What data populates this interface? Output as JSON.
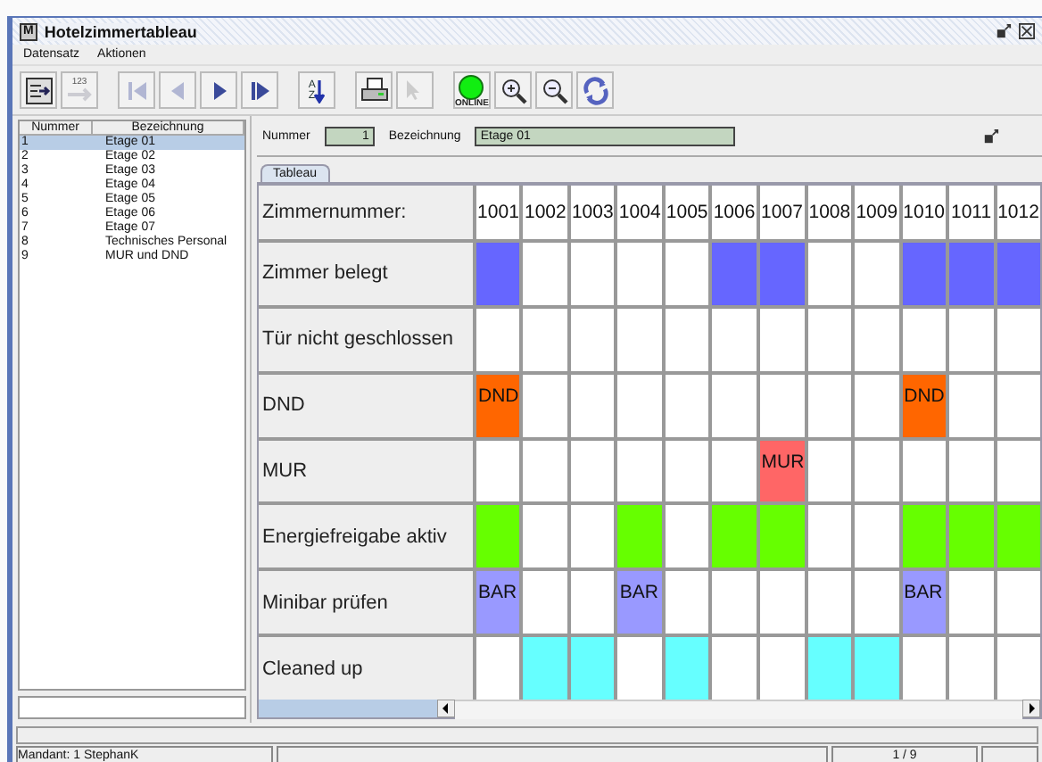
{
  "window": {
    "app_icon": "M",
    "title": "Hotelzimmertableau"
  },
  "menu": [
    "Datensatz",
    "Aktionen"
  ],
  "toolbar": [
    {
      "kind": "form",
      "disabled": false
    },
    {
      "kind": "number-arrow",
      "label": "123",
      "disabled": true
    },
    {
      "kind": "first",
      "disabled": true
    },
    {
      "kind": "prev",
      "disabled": true
    },
    {
      "kind": "next",
      "disabled": false
    },
    {
      "kind": "last",
      "disabled": false
    },
    {
      "kind": "sort",
      "label": "AZ",
      "disabled": false
    },
    {
      "kind": "print",
      "disabled": false
    },
    {
      "kind": "help",
      "disabled": true
    },
    {
      "kind": "online",
      "label": "ONLINE",
      "disabled": false
    },
    {
      "kind": "zoom-in",
      "disabled": false
    },
    {
      "kind": "zoom-out",
      "disabled": false
    },
    {
      "kind": "refresh",
      "disabled": false
    }
  ],
  "floor_list": {
    "columns": [
      "Nummer",
      "Bezeichnung"
    ],
    "rows": [
      {
        "number": "1",
        "name": "Etage 01",
        "selected": true
      },
      {
        "number": "2",
        "name": "Etage 02",
        "selected": false
      },
      {
        "number": "3",
        "name": "Etage 03",
        "selected": false
      },
      {
        "number": "4",
        "name": "Etage 04",
        "selected": false
      },
      {
        "number": "5",
        "name": "Etage 05",
        "selected": false
      },
      {
        "number": "6",
        "name": "Etage 06",
        "selected": false
      },
      {
        "number": "7",
        "name": "Etage 07",
        "selected": false
      },
      {
        "number": "8",
        "name": "Technisches Personal",
        "selected": false
      },
      {
        "number": "9",
        "name": "MUR und DND",
        "selected": false
      }
    ]
  },
  "record": {
    "number_label": "Nummer",
    "number": "1",
    "name_label": "Bezeichnung",
    "name": "Etage 01"
  },
  "tabs": [
    {
      "label": "Tableau",
      "selected": true
    }
  ],
  "tableau": {
    "header": "Zimmernummer:",
    "rooms": [
      "1001",
      "1002",
      "1003",
      "1004",
      "1005",
      "1006",
      "1007",
      "1008",
      "1009",
      "1010",
      "1011",
      "1012"
    ],
    "rows": [
      {
        "label": "Zimmer belegt",
        "cells": [
          {
            "color": "#6666ff"
          },
          {
            "color": "#ffffff"
          },
          {
            "color": "#ffffff"
          },
          {
            "color": "#ffffff"
          },
          {
            "color": "#ffffff"
          },
          {
            "color": "#6666ff"
          },
          {
            "color": "#6666ff"
          },
          {
            "color": "#ffffff"
          },
          {
            "color": "#ffffff"
          },
          {
            "color": "#6666ff"
          },
          {
            "color": "#6666ff"
          },
          {
            "color": "#6666ff"
          }
        ]
      },
      {
        "label": "Tür nicht geschlossen",
        "cells": [
          {
            "color": "#ffffff"
          },
          {
            "color": "#ffffff"
          },
          {
            "color": "#ffffff"
          },
          {
            "color": "#ffffff"
          },
          {
            "color": "#ffffff"
          },
          {
            "color": "#ffffff"
          },
          {
            "color": "#ffffff"
          },
          {
            "color": "#ffffff"
          },
          {
            "color": "#ffffff"
          },
          {
            "color": "#ffffff"
          },
          {
            "color": "#ffffff"
          },
          {
            "color": "#ffffff"
          }
        ]
      },
      {
        "label": "DND",
        "cells": [
          {
            "color": "#ff6600",
            "text": "DND"
          },
          {
            "color": "#ffffff"
          },
          {
            "color": "#ffffff"
          },
          {
            "color": "#ffffff"
          },
          {
            "color": "#ffffff"
          },
          {
            "color": "#ffffff"
          },
          {
            "color": "#ffffff"
          },
          {
            "color": "#ffffff"
          },
          {
            "color": "#ffffff"
          },
          {
            "color": "#ff6600",
            "text": "DND"
          },
          {
            "color": "#ffffff"
          },
          {
            "color": "#ffffff"
          }
        ]
      },
      {
        "label": "MUR",
        "cells": [
          {
            "color": "#ffffff"
          },
          {
            "color": "#ffffff"
          },
          {
            "color": "#ffffff"
          },
          {
            "color": "#ffffff"
          },
          {
            "color": "#ffffff"
          },
          {
            "color": "#ffffff"
          },
          {
            "color": "#ff6666",
            "text": "MUR"
          },
          {
            "color": "#ffffff"
          },
          {
            "color": "#ffffff"
          },
          {
            "color": "#ffffff"
          },
          {
            "color": "#ffffff"
          },
          {
            "color": "#ffffff"
          }
        ]
      },
      {
        "label": "Energiefreigabe aktiv",
        "cells": [
          {
            "color": "#66ff00"
          },
          {
            "color": "#ffffff"
          },
          {
            "color": "#ffffff"
          },
          {
            "color": "#66ff00"
          },
          {
            "color": "#ffffff"
          },
          {
            "color": "#66ff00"
          },
          {
            "color": "#66ff00"
          },
          {
            "color": "#ffffff"
          },
          {
            "color": "#ffffff"
          },
          {
            "color": "#66ff00"
          },
          {
            "color": "#66ff00"
          },
          {
            "color": "#66ff00"
          }
        ]
      },
      {
        "label": "Minibar prüfen",
        "cells": [
          {
            "color": "#9999ff",
            "text": "BAR"
          },
          {
            "color": "#ffffff"
          },
          {
            "color": "#ffffff"
          },
          {
            "color": "#9999ff",
            "text": "BAR"
          },
          {
            "color": "#ffffff"
          },
          {
            "color": "#ffffff"
          },
          {
            "color": "#ffffff"
          },
          {
            "color": "#ffffff"
          },
          {
            "color": "#ffffff"
          },
          {
            "color": "#9999ff",
            "text": "BAR"
          },
          {
            "color": "#ffffff"
          },
          {
            "color": "#ffffff"
          }
        ]
      },
      {
        "label": "Cleaned up",
        "cells": [
          {
            "color": "#ffffff"
          },
          {
            "color": "#66ffff"
          },
          {
            "color": "#66ffff"
          },
          {
            "color": "#ffffff"
          },
          {
            "color": "#66ffff"
          },
          {
            "color": "#ffffff"
          },
          {
            "color": "#ffffff"
          },
          {
            "color": "#66ffff"
          },
          {
            "color": "#66ffff"
          },
          {
            "color": "#ffffff"
          },
          {
            "color": "#ffffff"
          },
          {
            "color": "#ffffff"
          }
        ]
      }
    ]
  },
  "status_bar": {
    "user": "Mandant: 1   StephanK",
    "position": "1 / 9"
  }
}
